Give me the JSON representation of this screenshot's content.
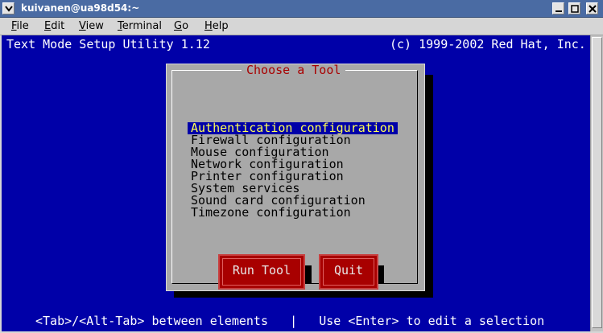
{
  "window": {
    "title": "kuivanen@ua98d54:~"
  },
  "menu": {
    "items": [
      {
        "label": "File",
        "accel": "F",
        "rest": "ile"
      },
      {
        "label": "Edit",
        "accel": "E",
        "rest": "dit"
      },
      {
        "label": "View",
        "accel": "V",
        "rest": "iew"
      },
      {
        "label": "Terminal",
        "accel": "T",
        "rest": "erminal"
      },
      {
        "label": "Go",
        "accel": "G",
        "rest": "o"
      },
      {
        "label": "Help",
        "accel": "H",
        "rest": "elp"
      }
    ]
  },
  "terminal": {
    "header_left": "Text Mode Setup Utility 1.12",
    "header_right": "(c) 1999-2002 Red Hat, Inc.",
    "footer": "<Tab>/<Alt-Tab> between elements   |   Use <Enter> to edit a selection"
  },
  "dialog": {
    "title": "Choose a Tool",
    "items": [
      "Authentication configuration",
      "Firewall configuration",
      "Mouse configuration",
      "Network configuration",
      "Printer configuration",
      "System services",
      "Sound card configuration",
      "Timezone configuration"
    ],
    "selected_index": 0,
    "run_label": "Run Tool",
    "quit_label": "Quit"
  },
  "colors": {
    "terminal_bg": "#0000a8",
    "dialog_bg": "#a8a8a8",
    "button_bg": "#a80000",
    "selection_fg": "#ffff54",
    "title_fg": "#a80000"
  }
}
